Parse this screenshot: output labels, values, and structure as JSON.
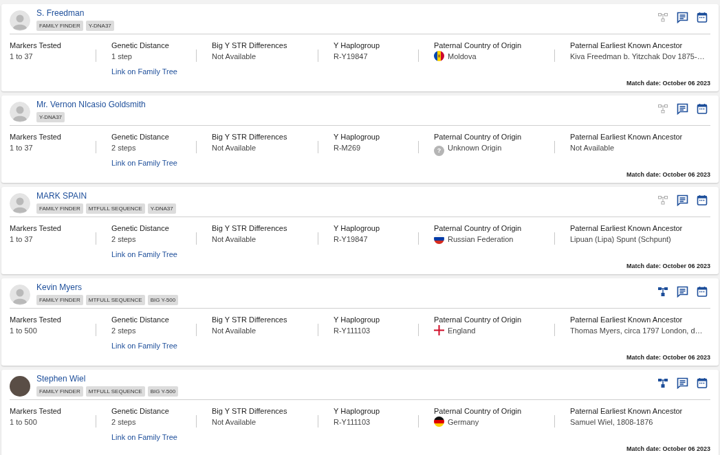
{
  "matches": [
    {
      "name": "S. Freedman",
      "avatar": {
        "kind": "silhouette"
      },
      "tags": [
        "FAMILY FINDER",
        "Y-DNA37"
      ],
      "tree_linked": false,
      "columns": [
        {
          "label": "Markers Tested",
          "value": "1 to 37"
        },
        {
          "label": "Genetic Distance",
          "value": "1 step",
          "link": "Link on Family Tree"
        },
        {
          "label": "Big Y STR Differences",
          "value": "Not Available"
        },
        {
          "label": "Y Haplogroup",
          "value": "R-Y19847"
        },
        {
          "label": "Paternal Country of Origin",
          "value": "Moldova",
          "flag": {
            "kind": "moldova"
          }
        },
        {
          "label": "Paternal Earliest Known Ancestor",
          "value": "Kiva Freedman b. Yitzchak Dov 1875-…"
        }
      ],
      "match_date": "Match date: October 06 2023"
    },
    {
      "name": "Mr. Vernon NIcasio Goldsmith",
      "avatar": {
        "kind": "silhouette"
      },
      "tags": [
        "Y-DNA37"
      ],
      "tree_linked": false,
      "columns": [
        {
          "label": "Markers Tested",
          "value": "1 to 37"
        },
        {
          "label": "Genetic Distance",
          "value": "2 steps",
          "link": "Link on Family Tree"
        },
        {
          "label": "Big Y STR Differences",
          "value": "Not Available"
        },
        {
          "label": "Y Haplogroup",
          "value": "R-M269"
        },
        {
          "label": "Paternal Country of Origin",
          "value": "Unknown Origin",
          "flag": {
            "kind": "unknown",
            "text": "?"
          }
        },
        {
          "label": "Paternal Earliest Known Ancestor",
          "value": "Not Available"
        }
      ],
      "match_date": "Match date: October 06 2023"
    },
    {
      "name": "MARK SPAIN",
      "avatar": {
        "kind": "silhouette"
      },
      "tags": [
        "FAMILY FINDER",
        "MTFULL SEQUENCE",
        "Y-DNA37"
      ],
      "tree_linked": false,
      "columns": [
        {
          "label": "Markers Tested",
          "value": "1 to 37"
        },
        {
          "label": "Genetic Distance",
          "value": "2 steps",
          "link": "Link on Family Tree"
        },
        {
          "label": "Big Y STR Differences",
          "value": "Not Available"
        },
        {
          "label": "Y Haplogroup",
          "value": "R-Y19847"
        },
        {
          "label": "Paternal Country of Origin",
          "value": "Russian Federation",
          "flag": {
            "kind": "russia"
          }
        },
        {
          "label": "Paternal Earliest Known Ancestor",
          "value": "Lipuan (Lipa) Spunt (Schpunt)"
        }
      ],
      "match_date": "Match date: October 06 2023"
    },
    {
      "name": "Kevin Myers",
      "avatar": {
        "kind": "silhouette"
      },
      "tags": [
        "FAMILY FINDER",
        "MTFULL SEQUENCE",
        "BIG Y-500"
      ],
      "tree_linked": true,
      "columns": [
        {
          "label": "Markers Tested",
          "value": "1 to 500"
        },
        {
          "label": "Genetic Distance",
          "value": "2 steps",
          "link": "Link on Family Tree"
        },
        {
          "label": "Big Y STR Differences",
          "value": "Not Available"
        },
        {
          "label": "Y Haplogroup",
          "value": "R-Y111103"
        },
        {
          "label": "Paternal Country of Origin",
          "value": "England",
          "flag": {
            "kind": "england"
          }
        },
        {
          "label": "Paternal Earliest Known Ancestor",
          "value": "Thomas Myers, circa 1797 London, d…"
        }
      ],
      "match_date": "Match date: October 06 2023"
    },
    {
      "name": "Stephen Wiel",
      "avatar": {
        "kind": "photo"
      },
      "tags": [
        "FAMILY FINDER",
        "MTFULL SEQUENCE",
        "BIG Y-500"
      ],
      "tree_linked": true,
      "columns": [
        {
          "label": "Markers Tested",
          "value": "1 to 500"
        },
        {
          "label": "Genetic Distance",
          "value": "2 steps",
          "link": "Link on Family Tree"
        },
        {
          "label": "Big Y STR Differences",
          "value": "Not Available"
        },
        {
          "label": "Y Haplogroup",
          "value": "R-Y111103"
        },
        {
          "label": "Paternal Country of Origin",
          "value": "Germany",
          "flag": {
            "kind": "germany"
          }
        },
        {
          "label": "Paternal Earliest Known Ancestor",
          "value": "Samuel Wiel, 1808-1876"
        }
      ],
      "match_date": "Match date: October 06 2023"
    }
  ]
}
